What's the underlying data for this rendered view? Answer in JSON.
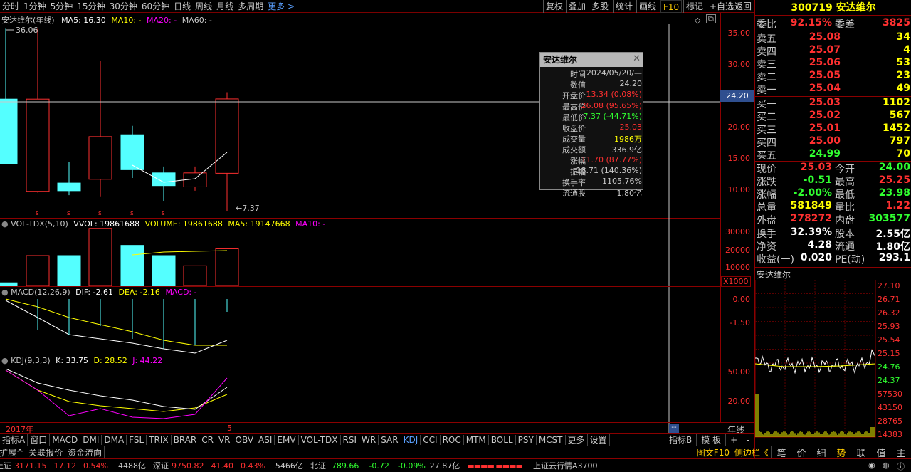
{
  "topbar": {
    "periods": [
      "分时",
      "1分钟",
      "5分钟",
      "15分钟",
      "30分钟",
      "60分钟",
      "日线",
      "周线",
      "月线",
      "多周期",
      "更多 >"
    ],
    "right_buttons": [
      "复权",
      "叠加",
      "多股",
      "统计",
      "画线",
      "F10",
      "标记",
      "+自选",
      "返回"
    ]
  },
  "main_chart": {
    "title": "安达维尔(年线)",
    "ma5": "MA5: 16.30",
    "ma10": "MA10: -",
    "ma20": "MA20: -",
    "ma60": "MA60: -",
    "high_label": "36.06",
    "low_label": "7.37",
    "y_ticks": [
      "35.00",
      "30.00",
      "25.00",
      "20.00",
      "15.00",
      "10.00"
    ],
    "cursor_value": "24.20",
    "s_marks": [
      "s",
      "s",
      "s",
      "s",
      "s"
    ]
  },
  "chart_data": {
    "type": "candlestick",
    "candles": [
      {
        "open": 25.0,
        "close": 14.8,
        "high": 36.06,
        "low": 14.8
      },
      {
        "open": 10.5,
        "close": 25.0,
        "high": 36.06,
        "low": 10.3
      },
      {
        "open": 11.8,
        "close": 10.6,
        "high": 15.1,
        "low": 9.9
      },
      {
        "open": 12.4,
        "close": 19.1,
        "high": 31.0,
        "low": 9.6
      },
      {
        "open": 19.4,
        "close": 13.9,
        "high": 20.8,
        "low": 12.6
      },
      {
        "open": 13.4,
        "close": 11.4,
        "high": 14.4,
        "low": 8.9
      },
      {
        "open": 11.2,
        "close": 13.4,
        "high": 14.4,
        "low": 10.6
      },
      {
        "open": 13.34,
        "close": 25.03,
        "high": 26.08,
        "low": 7.37
      }
    ],
    "volume": [
      1,
      9,
      9,
      17,
      12,
      9,
      6,
      11
    ],
    "ylim": [
      7,
      37
    ]
  },
  "volume_panel": {
    "title": "VOL-TDX(5,10)",
    "vvol": "VVOL: 19861688",
    "volume": "VOLUME: 19861688",
    "ma5": "MA5: 19147668",
    "ma10": "MA10: -",
    "y_ticks": [
      "30000",
      "20000",
      "10000"
    ],
    "unit": "X1000"
  },
  "macd_panel": {
    "title": "MACD(12,26,9)",
    "dif": "DIF: -2.61",
    "dea": "DEA: -2.16",
    "macd": "MACD: -",
    "y_ticks": [
      "0.00",
      "-1.50"
    ]
  },
  "kdj_panel": {
    "title": "KDJ(9,3,3)",
    "k": "K: 33.75",
    "d": "D: 28.52",
    "j": "J: 44.22",
    "y_ticks": [
      "50.00",
      "20.00"
    ]
  },
  "xaxis": {
    "start": "2017年",
    "mark": "5",
    "period": "年线"
  },
  "tooltip": {
    "title": "安达维尔",
    "rows": [
      {
        "k": "时间",
        "v": "2024/05/20/—",
        "c": "#c8c8c8"
      },
      {
        "k": "数值",
        "v": "24.20",
        "c": "#c8c8c8"
      },
      {
        "k": "开盘价",
        "v": "13.34 (0.08%)",
        "c": "#ff3030"
      },
      {
        "k": "最高价",
        "v": "26.08 (95.65%)",
        "c": "#ff3030"
      },
      {
        "k": "最低价",
        "v": "7.37 (-44.71%)",
        "c": "#30ff30"
      },
      {
        "k": "收盘价",
        "v": "25.03",
        "c": "#ff3030"
      },
      {
        "k": "成交量",
        "v": "1986万",
        "c": "#ffff00"
      },
      {
        "k": "成交额",
        "v": "336.9亿",
        "c": "#c8c8c8"
      },
      {
        "k": "涨幅",
        "v": "11.70 (87.77%)",
        "c": "#ff3030"
      },
      {
        "k": "振幅",
        "v": "18.71 (140.36%)",
        "c": "#c8c8c8"
      },
      {
        "k": "换手率",
        "v": "1105.76%",
        "c": "#c8c8c8"
      },
      {
        "k": "流通股",
        "v": "1.80亿",
        "c": "#c8c8c8"
      }
    ]
  },
  "quote": {
    "code": "300719",
    "name": "安达维尔",
    "weibi_label": "委比",
    "weibi": "92.15%",
    "weicha_label": "委差",
    "weicha": "3825",
    "asks": [
      {
        "l": "卖五",
        "p": "25.08",
        "q": "34"
      },
      {
        "l": "卖四",
        "p": "25.07",
        "q": "4"
      },
      {
        "l": "卖三",
        "p": "25.06",
        "q": "53"
      },
      {
        "l": "卖二",
        "p": "25.05",
        "q": "23"
      },
      {
        "l": "卖一",
        "p": "25.04",
        "q": "49"
      }
    ],
    "bids": [
      {
        "l": "买一",
        "p": "25.03",
        "q": "1102"
      },
      {
        "l": "买二",
        "p": "25.02",
        "q": "567"
      },
      {
        "l": "买三",
        "p": "25.01",
        "q": "1452"
      },
      {
        "l": "买四",
        "p": "25.00",
        "q": "797"
      },
      {
        "l": "买五",
        "p": "24.99",
        "q": "70"
      }
    ],
    "stats": [
      {
        "l": "现价",
        "v": "25.03",
        "vc": "#ff3030",
        "l2": "今开",
        "v2": "24.00",
        "v2c": "#30ff30"
      },
      {
        "l": "涨跌",
        "v": "-0.51",
        "vc": "#30ff30",
        "l2": "最高",
        "v2": "25.25",
        "v2c": "#ff3030"
      },
      {
        "l": "涨幅",
        "v": "-2.00%",
        "vc": "#30ff30",
        "l2": "最低",
        "v2": "23.98",
        "v2c": "#30ff30"
      },
      {
        "l": "总量",
        "v": "581849",
        "vc": "#ffff00",
        "l2": "量比",
        "v2": "1.22",
        "v2c": "#ff3030"
      },
      {
        "l": "外盘",
        "v": "278272",
        "vc": "#ff3030",
        "l2": "内盘",
        "v2": "303577",
        "v2c": "#30ff30"
      }
    ],
    "stats2": [
      {
        "l": "换手",
        "v": "32.39%",
        "l2": "股本",
        "v2": "2.55亿"
      },
      {
        "l": "净资",
        "v": "4.28",
        "l2": "流通",
        "v2": "1.80亿"
      },
      {
        "l": "收益(一)",
        "v": "0.020",
        "l2": "PE(动)",
        "v2": "293.1"
      }
    ],
    "mini_title": "安达维尔",
    "mini_prices": [
      "27.10",
      "26.71",
      "26.32",
      "25.93",
      "25.54",
      "25.15",
      "24.76",
      "24.37",
      "57530",
      "43150",
      "28765",
      "14383"
    ]
  },
  "indicator_tabs": [
    "指标A",
    "窗口",
    "MACD",
    "DMI",
    "DMA",
    "FSL",
    "TRIX",
    "BRAR",
    "CR",
    "VR",
    "OBV",
    "ASI",
    "EMV",
    "VOL-TDX",
    "RSI",
    "WR",
    "SAR",
    "KDJ",
    "CCI",
    "ROC",
    "MTM",
    "BOLL",
    "PSY",
    "MCST",
    "更多",
    "设置"
  ],
  "indicator_right": [
    "指标B",
    "模 板",
    "+",
    "-"
  ],
  "bottom_left": [
    "扩展^",
    "关联报价",
    "资金流向"
  ],
  "bottom_right": {
    "label": "图文F10",
    "side": "侧边栏《",
    "tabs": [
      "笔",
      "价",
      "细",
      "势",
      "联",
      "值",
      "主"
    ]
  },
  "status": {
    "sh_label": "上证",
    "sh": "3171.15",
    "sh_ch": "17.12",
    "sh_pct": "0.54%",
    "sh_amt": "4488亿",
    "sz_label": "深证",
    "sz": "9750.82",
    "sz_ch": "41.40",
    "sz_pct": "0.43%",
    "sz_amt": "5466亿",
    "bz_label": "北证",
    "bz": "789.66",
    "bz_ch": "-0.72",
    "bz_pct": "-0.09%",
    "bz_amt": "27.87亿",
    "ticker": "上证云行情A3700"
  }
}
